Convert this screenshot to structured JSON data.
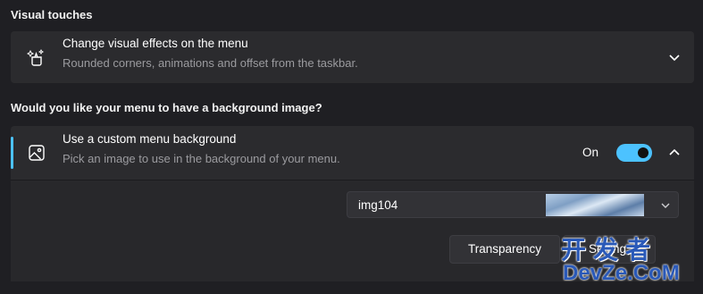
{
  "visual_touches": {
    "heading": "Visual touches",
    "row": {
      "icon": "sparkle-paint-icon",
      "title": "Change visual effects on the menu",
      "description": "Rounded corners, animations and offset from the taskbar.",
      "expand_icon": "chevron-down-icon"
    }
  },
  "background_image": {
    "heading": "Would you like your menu to have a background image?",
    "row": {
      "icon": "image-icon",
      "title": "Use a custom menu background",
      "description": "Pick an image to use in the background of your menu.",
      "toggle_state_label": "On",
      "toggle_on": true,
      "collapse_icon": "chevron-up-icon"
    },
    "image_select": {
      "value": "img104",
      "dropdown_icon": "chevron-down-icon"
    },
    "buttons": {
      "transparency": "Transparency",
      "settings_partial": "Setting"
    }
  },
  "watermark": {
    "top_text": "开发者",
    "bottom_text": "DevZe.CoM"
  },
  "colors": {
    "accent": "#4cc2ff",
    "card": "#2b2b2e",
    "background": "#1f1f23",
    "watermark": "#2a59b8"
  }
}
